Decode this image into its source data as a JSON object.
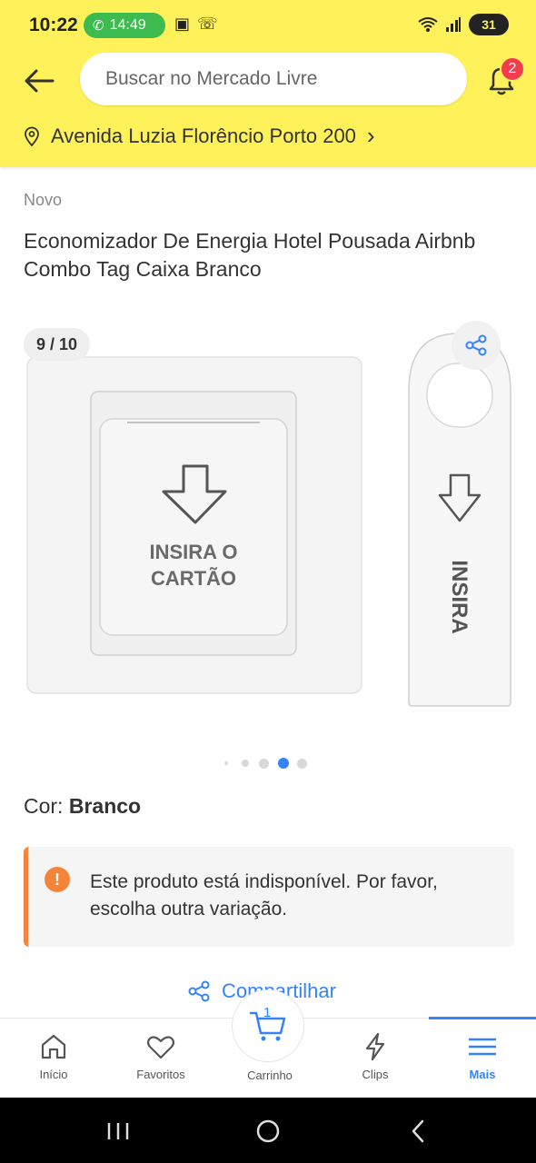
{
  "status_bar": {
    "time": "10:22",
    "call_duration": "14:49",
    "battery": "31"
  },
  "header": {
    "search_placeholder": "Buscar no Mercado Livre",
    "notifications_count": "2",
    "address": "Avenida Luzia Florêncio Porto 200",
    "address_chevron": "›",
    "brand_color": "#fff159"
  },
  "product": {
    "condition": "Novo",
    "title": "Economizador De Energia Hotel Pousada Airbnb Combo Tag Caixa Branco",
    "image_counter": "9 / 10",
    "image": {
      "switch_text_line1": "INSIRA O",
      "switch_text_line2": "CARTÃO",
      "tag_text": "INSIRA"
    },
    "gallery_dots": {
      "count": 5,
      "active_index": 3
    },
    "color_label": "Cor:",
    "color_value": "Branco"
  },
  "warning": {
    "icon": "!",
    "message": "Este produto está indisponível. Por favor, escolha outra variação."
  },
  "share_link": {
    "label": "Compartilhar",
    "partially_covered": true
  },
  "bottom_nav": {
    "items": [
      {
        "label": "Início",
        "icon": "home-icon"
      },
      {
        "label": "Favoritos",
        "icon": "heart-icon"
      },
      {
        "label": "Carrinho",
        "icon": "cart-icon",
        "badge": "1"
      },
      {
        "label": "Clips",
        "icon": "lightning-icon"
      },
      {
        "label": "Mais",
        "icon": "menu-icon",
        "active": true
      }
    ],
    "accent_color": "#3483fa"
  }
}
